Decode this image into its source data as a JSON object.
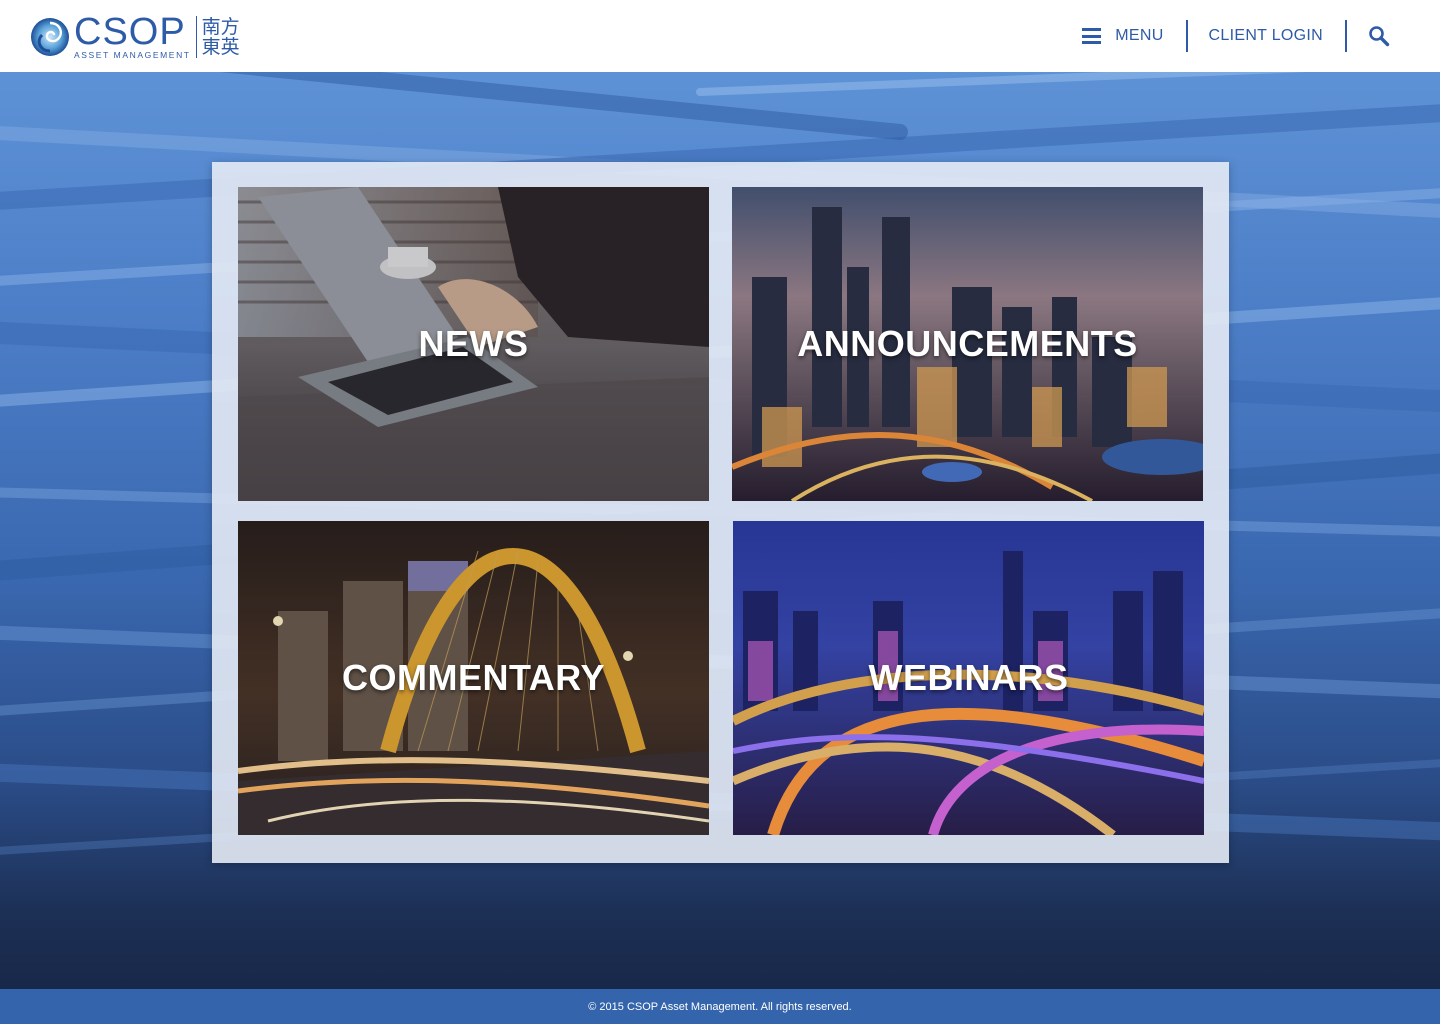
{
  "brand": {
    "name": "CSOP",
    "subtitle": "ASSET MANAGEMENT",
    "chinese_line1": "南方",
    "chinese_line2": "東英",
    "color": "#2e5ba8"
  },
  "nav": {
    "menu_label": "MENU",
    "menu_icon": "hamburger-icon",
    "client_login_label": "CLIENT LOGIN",
    "search_icon": "search-icon"
  },
  "tiles": [
    {
      "label": "NEWS",
      "image": "laptop-typing-photo"
    },
    {
      "label": "ANNOUNCEMENTS",
      "image": "city-skyline-night-photo"
    },
    {
      "label": "COMMENTARY",
      "image": "arch-bridge-night-photo"
    },
    {
      "label": "WEBINARS",
      "image": "highway-interchange-night-photo"
    }
  ],
  "footer": {
    "copyright": "© 2015 CSOP Asset Management. All rights reserved."
  }
}
